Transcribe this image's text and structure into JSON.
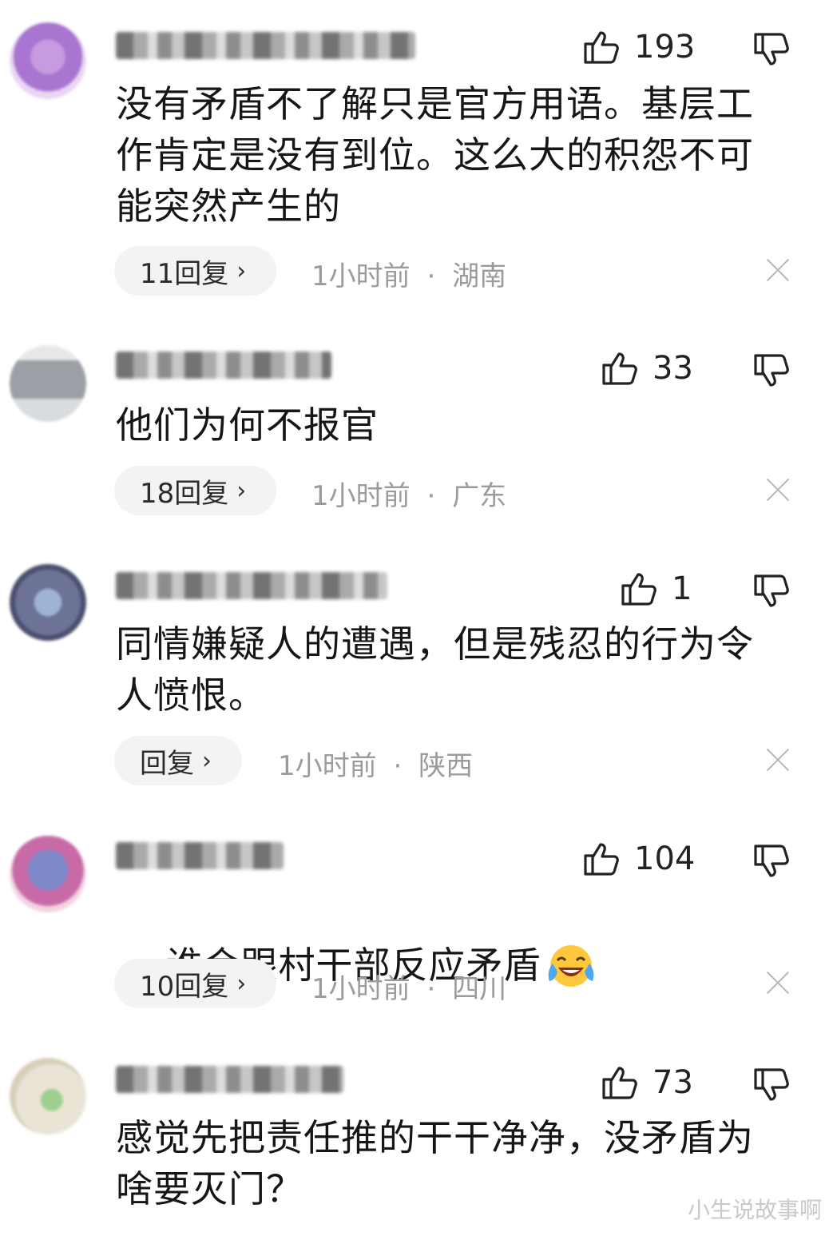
{
  "comments": [
    {
      "likes": "193",
      "text": "没有矛盾不了解只是官方用语。基层工作肯定是没有到位。这么大的积怨不可能突然产生的",
      "replies": "11回复",
      "time": "1小时前",
      "location": "湖南"
    },
    {
      "likes": "33",
      "text": "他们为何不报官",
      "replies": "18回复",
      "time": "1小时前",
      "location": "广东"
    },
    {
      "likes": "1",
      "text": "同情嫌疑人的遭遇，但是残忍的行为令人愤恨。",
      "replies": "回复",
      "time": "1小时前",
      "location": "陕西"
    },
    {
      "likes": "104",
      "text": "谁会跟村干部反应矛盾",
      "emoji": "laughing-crying-emoji",
      "replies": "10回复",
      "time": "1小时前",
      "location": "四川"
    },
    {
      "likes": "73",
      "text": "感觉先把责任推的干干净净，没矛盾为啥要灭门？"
    }
  ],
  "separator": "·",
  "chevron": "›",
  "watermark": "小生说故事啊",
  "colors": {
    "meta": "#9b9b9b",
    "pill": "#f3f3f3",
    "text": "#161616"
  }
}
